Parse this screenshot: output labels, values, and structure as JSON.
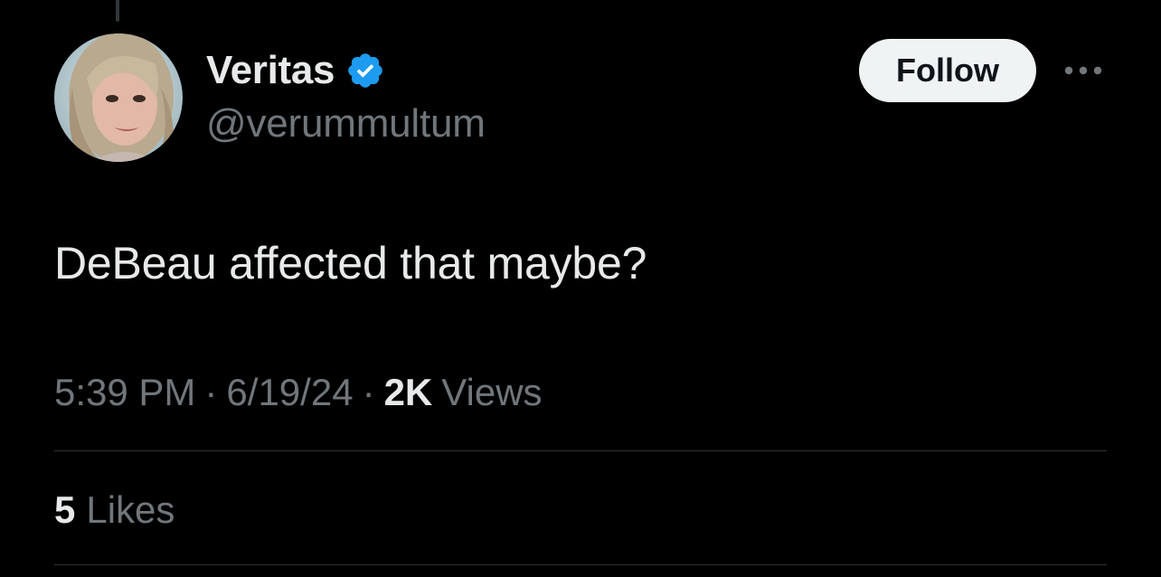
{
  "author": {
    "display_name": "Veritas",
    "handle": "@verummultum",
    "verified": true,
    "avatar": "profile-photo-woman-light-hair"
  },
  "actions": {
    "follow_label": "Follow",
    "more_icon": "more-dots-icon"
  },
  "tweet": {
    "text": "DeBeau affected that maybe?",
    "time": "5:39 PM",
    "date": "6/19/24",
    "separator": "·",
    "views_count": "2K",
    "views_label": "Views"
  },
  "engagement": {
    "likes_count": "5",
    "likes_label": "Likes"
  },
  "colors": {
    "background": "#000000",
    "primary_text": "#e7e9ea",
    "secondary_text": "#71767b",
    "verified_blue": "#1d9bf0",
    "divider": "#2f3336",
    "follow_button_bg": "#eff3f4"
  }
}
